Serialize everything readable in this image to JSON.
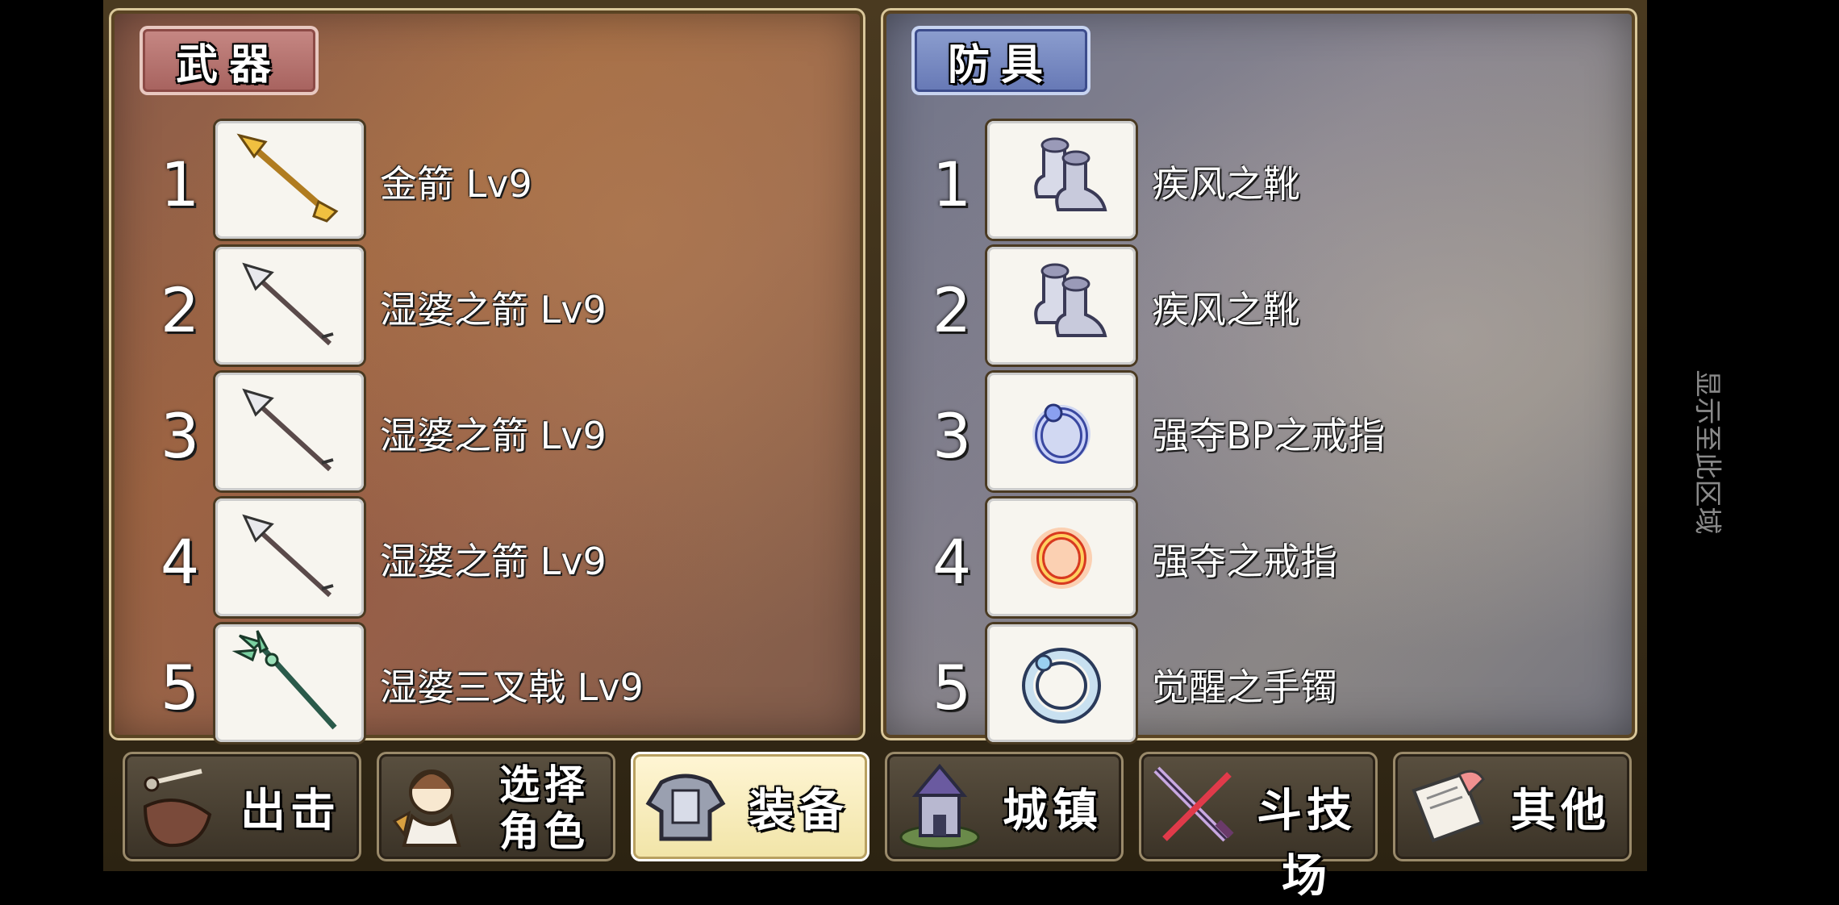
{
  "weapons": {
    "tab_label": "武器",
    "items": [
      {
        "index": "1",
        "name": "金箭 Lv9",
        "icon": "gold-arrow-icon"
      },
      {
        "index": "2",
        "name": "湿婆之箭 Lv9",
        "icon": "arrow-icon"
      },
      {
        "index": "3",
        "name": "湿婆之箭 Lv9",
        "icon": "arrow-icon"
      },
      {
        "index": "4",
        "name": "湿婆之箭 Lv9",
        "icon": "arrow-icon"
      },
      {
        "index": "5",
        "name": "湿婆三叉戟 Lv9",
        "icon": "trident-icon"
      }
    ]
  },
  "armor": {
    "tab_label": "防具",
    "items": [
      {
        "index": "1",
        "name": "疾风之靴",
        "icon": "boots-icon"
      },
      {
        "index": "2",
        "name": "疾风之靴",
        "icon": "boots-icon"
      },
      {
        "index": "3",
        "name": "强夺BP之戒指",
        "icon": "blue-ring-icon"
      },
      {
        "index": "4",
        "name": "强夺之戒指",
        "icon": "red-ring-icon"
      },
      {
        "index": "5",
        "name": "觉醒之手镯",
        "icon": "bracelet-icon"
      }
    ]
  },
  "menu": {
    "sortie": "出击",
    "select_character_line1": "选择",
    "select_character_line2": "角色",
    "equipment": "装备",
    "town": "城镇",
    "arena": "斗技场",
    "other": "其他",
    "active": "equipment"
  },
  "system_hint": "显示至此区域",
  "colors": {
    "weapon_tab": "#b06a66",
    "armor_tab": "#6a7cb8",
    "active_button": "#f4e8b0"
  }
}
